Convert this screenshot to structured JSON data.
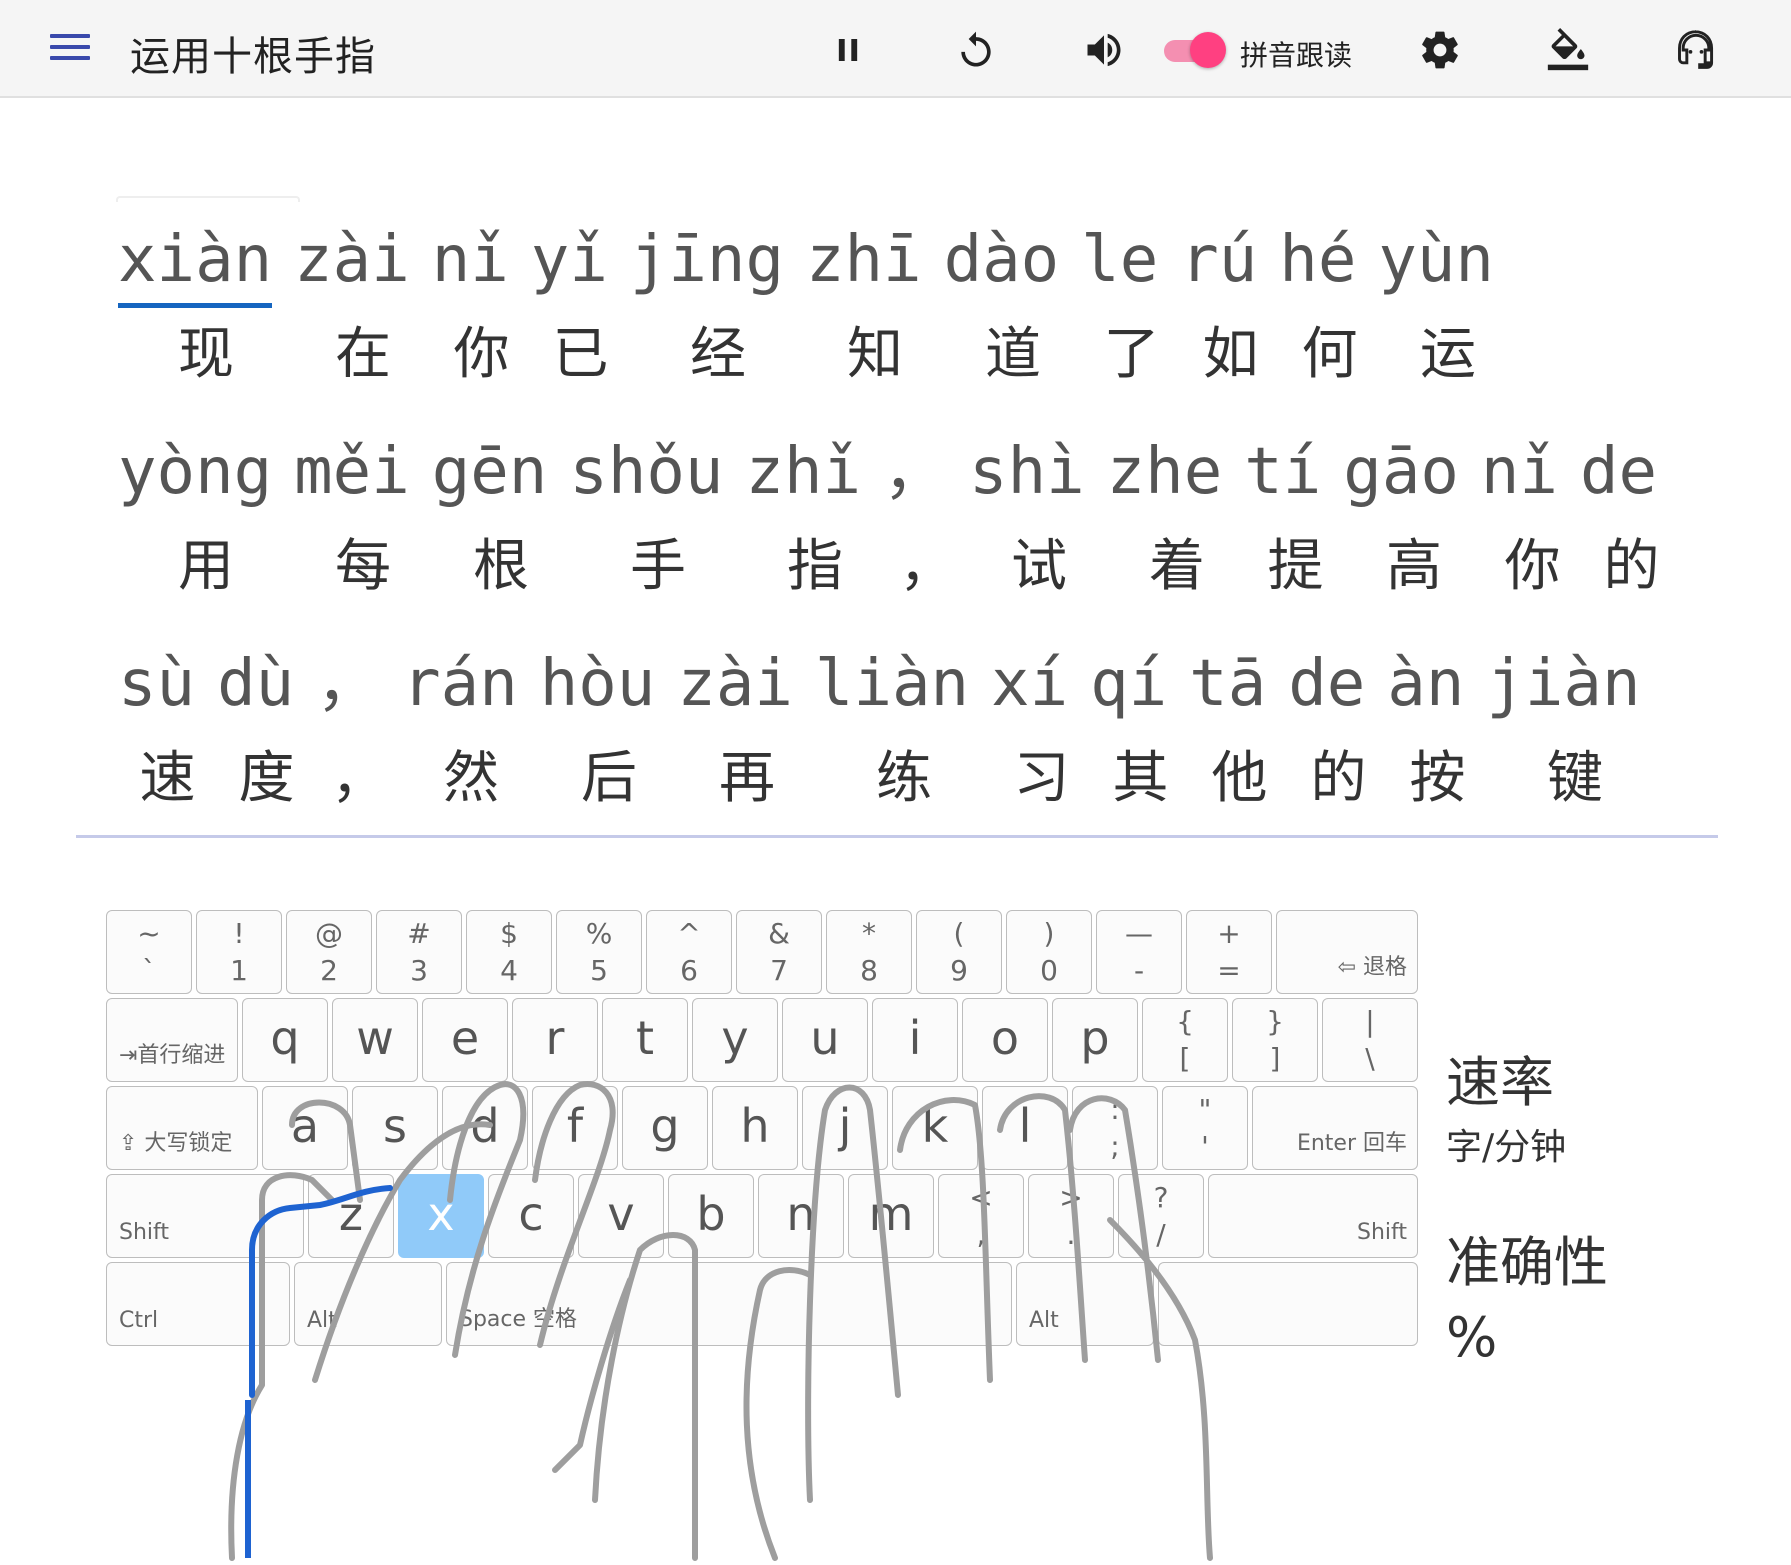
{
  "app": {
    "title": "运用十根手指"
  },
  "toolbar": {
    "pinyin_toggle_label": "拼音跟读",
    "pinyin_toggle_on": true,
    "accent": "#ff4081",
    "menu_color": "#3949ab"
  },
  "text": {
    "lines": [
      {
        "pinyin": [
          "xiàn",
          "zài",
          "nǐ",
          "yǐ",
          "jīng",
          "zhī",
          "dào",
          "le",
          "rú",
          "hé",
          "yùn"
        ],
        "hanzi": [
          "现",
          "在",
          "你",
          "已",
          "经",
          "知",
          "道",
          "了",
          "如",
          "何",
          "运"
        ]
      },
      {
        "pinyin": [
          "yòng",
          "měi",
          "gēn",
          "shǒu",
          "zhǐ",
          "，",
          "shì",
          "zhe",
          "tí",
          "gāo",
          "nǐ",
          "de"
        ],
        "hanzi": [
          "用",
          "每",
          "根",
          "手",
          "指",
          "，",
          "试",
          "着",
          "提",
          "高",
          "你",
          "的"
        ]
      },
      {
        "pinyin": [
          "sù",
          "dù",
          "，",
          "rán",
          "hòu",
          "zài",
          "liàn",
          "xí",
          "qí",
          "tā",
          "de",
          "àn",
          "jiàn"
        ],
        "hanzi": [
          "速",
          "度",
          "，",
          "然",
          "后",
          "再",
          "练",
          "习",
          "其",
          "他",
          "的",
          "按",
          "键"
        ]
      }
    ]
  },
  "keyboard": {
    "highlight_key": "x",
    "row1": [
      {
        "top": "~",
        "bottom": "`"
      },
      {
        "top": "!",
        "bottom": "1"
      },
      {
        "top": "@",
        "bottom": "2"
      },
      {
        "top": "#",
        "bottom": "3"
      },
      {
        "top": "$",
        "bottom": "4"
      },
      {
        "top": "%",
        "bottom": "5"
      },
      {
        "top": "^",
        "bottom": "6"
      },
      {
        "top": "&",
        "bottom": "7"
      },
      {
        "top": "*",
        "bottom": "8"
      },
      {
        "top": "(",
        "bottom": "9"
      },
      {
        "top": ")",
        "bottom": "0"
      },
      {
        "top": "—",
        "bottom": "-"
      },
      {
        "top": "+",
        "bottom": "="
      }
    ],
    "backspace": "⇦ 退格",
    "tab": "⇥首行缩进",
    "row2": [
      "q",
      "w",
      "e",
      "r",
      "t",
      "y",
      "u",
      "i",
      "o",
      "p"
    ],
    "row2_sym": [
      {
        "top": "{",
        "bottom": "["
      },
      {
        "top": "}",
        "bottom": "]"
      },
      {
        "top": "|",
        "bottom": "\\"
      }
    ],
    "caps": "⇪ 大写锁定",
    "row3": [
      "a",
      "s",
      "d",
      "f",
      "g",
      "h",
      "j",
      "k",
      "l"
    ],
    "row3_sym": [
      {
        "top": ":",
        "bottom": ";"
      },
      {
        "top": "\"",
        "bottom": "'"
      }
    ],
    "enter": "Enter 回车",
    "shift_left": "Shift",
    "row4": [
      "z",
      "x",
      "c",
      "v",
      "b",
      "n",
      "m"
    ],
    "row4_sym": [
      {
        "top": "<",
        "bottom": ","
      },
      {
        "top": ">",
        "bottom": "."
      },
      {
        "top": "?",
        "bottom": "/"
      }
    ],
    "shift_right": "Shift",
    "ctrl": "Ctrl",
    "alt_left": "Alt",
    "space": "Space 空格",
    "alt_right": "Alt"
  },
  "stats": {
    "speed_label": "速率",
    "speed_unit": "字/分钟",
    "accuracy_label": "准确性",
    "accuracy_unit": "%"
  }
}
